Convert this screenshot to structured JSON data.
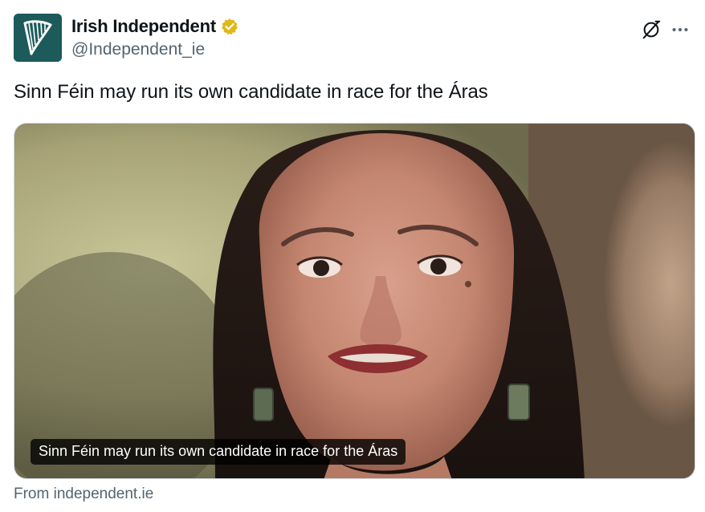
{
  "account": {
    "display_name": "Irish Independent",
    "handle": "@Independent_ie",
    "verified_badge_color": "#e2b719",
    "avatar_color": "#1d5a5a",
    "avatar_icon": "harp-icon"
  },
  "actions": {
    "grok_icon": "grok-icon",
    "more_icon": "more-icon"
  },
  "tweet": {
    "text": "Sinn Féin may run its own candidate in race for the Áras"
  },
  "link_card": {
    "caption": "Sinn Féin may run its own candidate in race for the Áras",
    "source": "From independent.ie"
  }
}
